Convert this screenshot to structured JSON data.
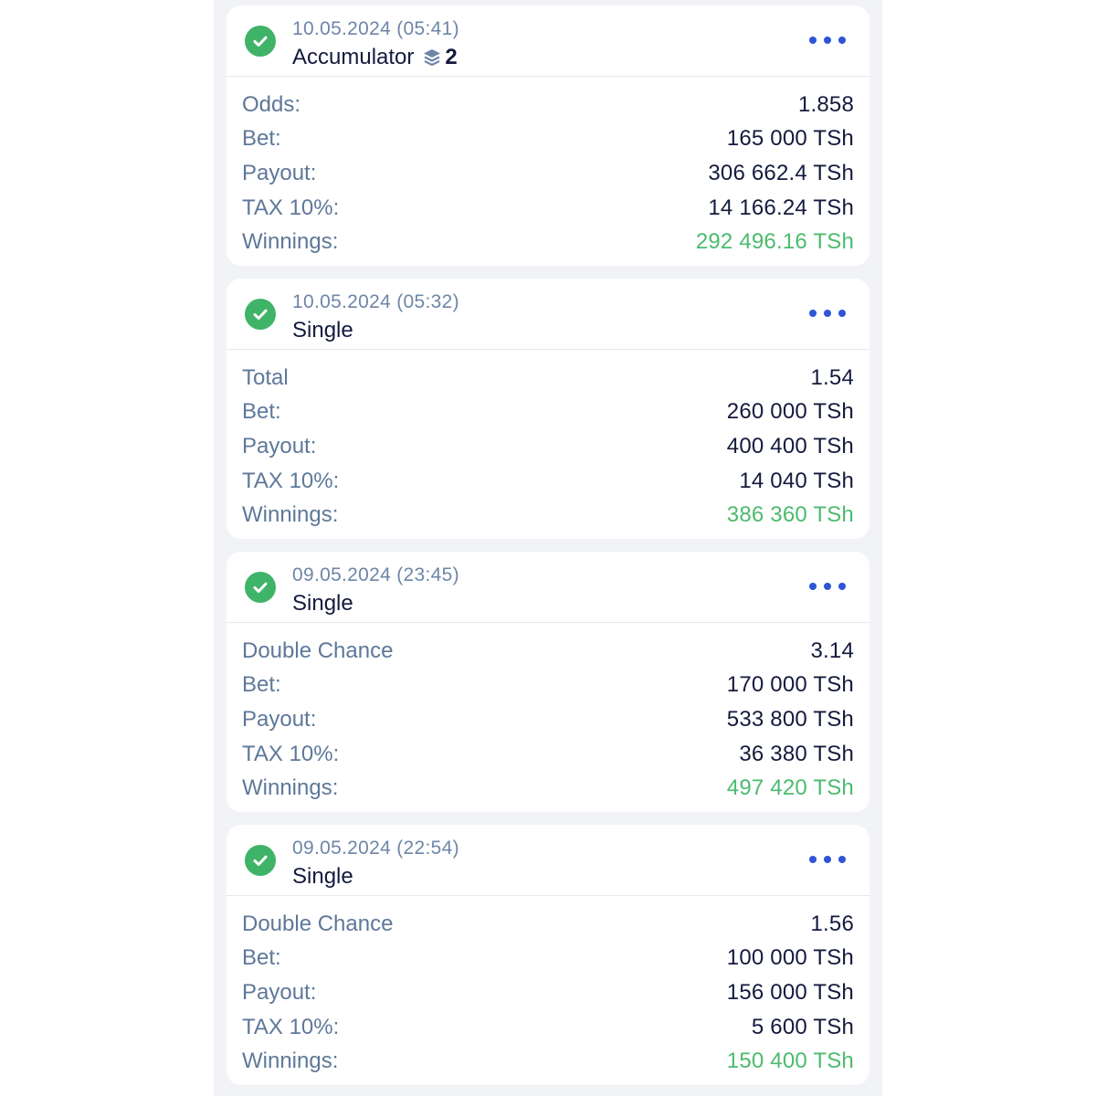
{
  "colors": {
    "accent": "#2f54d6",
    "success": "#3fb368",
    "winnings": "#4bbb6e",
    "label": "#5e7899",
    "value": "#141a3d"
  },
  "bets": [
    {
      "date": "10.05.2024 (05:41)",
      "type": "Accumulator",
      "selections": "2",
      "status_icon": "check-circle-icon",
      "rows": [
        {
          "label": "Odds:",
          "value": "1.858"
        },
        {
          "label": "Bet:",
          "value": "165 000 TSh"
        },
        {
          "label": "Payout:",
          "value": "306 662.4 TSh"
        },
        {
          "label": "TAX 10%:",
          "value": "14 166.24 TSh"
        },
        {
          "label": "Winnings:",
          "value": "292 496.16 TSh"
        }
      ]
    },
    {
      "date": "10.05.2024 (05:32)",
      "type": "Single",
      "status_icon": "check-circle-icon",
      "rows": [
        {
          "label": "Total",
          "value": "1.54"
        },
        {
          "label": "Bet:",
          "value": "260 000 TSh"
        },
        {
          "label": "Payout:",
          "value": "400 400 TSh"
        },
        {
          "label": "TAX 10%:",
          "value": "14 040 TSh"
        },
        {
          "label": "Winnings:",
          "value": "386 360 TSh"
        }
      ]
    },
    {
      "date": "09.05.2024 (23:45)",
      "type": "Single",
      "status_icon": "check-circle-icon",
      "rows": [
        {
          "label": "Double Chance",
          "value": "3.14"
        },
        {
          "label": "Bet:",
          "value": "170 000 TSh"
        },
        {
          "label": "Payout:",
          "value": "533 800 TSh"
        },
        {
          "label": "TAX 10%:",
          "value": "36 380 TSh"
        },
        {
          "label": "Winnings:",
          "value": "497 420 TSh"
        }
      ]
    },
    {
      "date": "09.05.2024 (22:54)",
      "type": "Single",
      "status_icon": "check-circle-icon",
      "rows": [
        {
          "label": "Double Chance",
          "value": "1.56"
        },
        {
          "label": "Bet:",
          "value": "100 000 TSh"
        },
        {
          "label": "Payout:",
          "value": "156 000 TSh"
        },
        {
          "label": "TAX 10%:",
          "value": "5 600 TSh"
        },
        {
          "label": "Winnings:",
          "value": "150 400 TSh"
        }
      ]
    }
  ]
}
